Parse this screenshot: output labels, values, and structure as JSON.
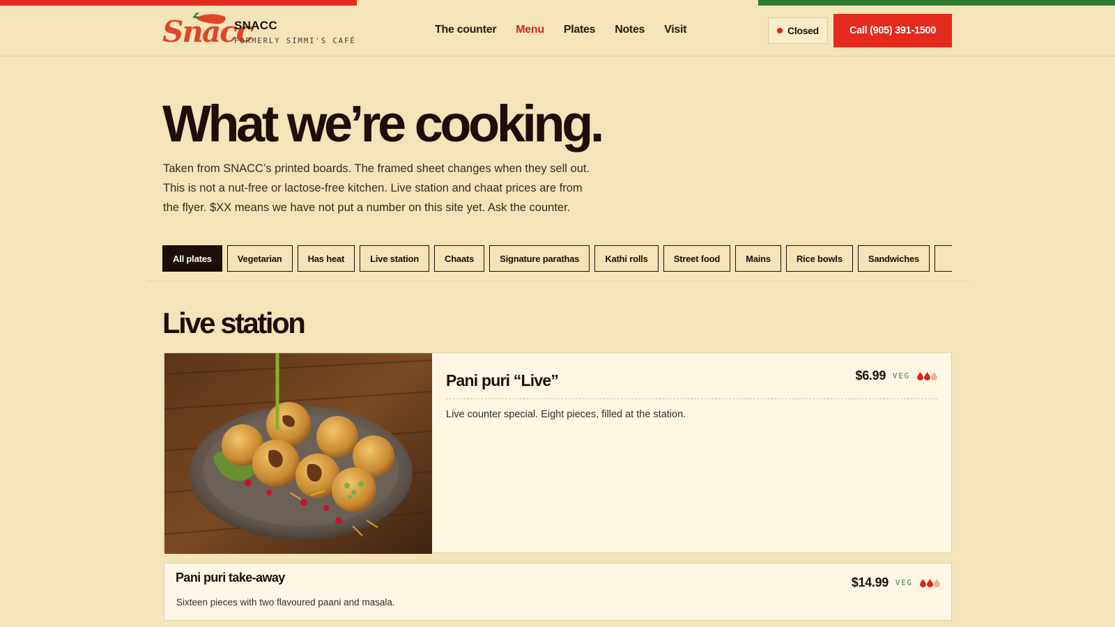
{
  "brand": {
    "logo_text": "Snacc",
    "name": "SNACC",
    "subtitle": "FORMERLY SIMMI'S CAFÉ"
  },
  "nav": {
    "items": [
      {
        "label": "The counter",
        "active": false
      },
      {
        "label": "Menu",
        "active": true
      },
      {
        "label": "Plates",
        "active": false
      },
      {
        "label": "Notes",
        "active": false
      },
      {
        "label": "Visit",
        "active": false
      }
    ]
  },
  "status": {
    "label": "Closed",
    "color": "#d72719"
  },
  "call_button": {
    "label": "Call (905) 391-1500"
  },
  "hero": {
    "title": "What we’re cooking.",
    "copy_lines": [
      "Taken from SNACC’s printed boards. The framed sheet changes when they sell out.",
      "This is not a nut-free or lactose-free kitchen. Live station and chaat prices are from",
      "the flyer. $XX means we have not put a number on this site yet. Ask the counter."
    ]
  },
  "filters": [
    {
      "label": "All plates",
      "active": true
    },
    {
      "label": "Vegetarian",
      "active": false
    },
    {
      "label": "Has heat",
      "active": false
    },
    {
      "label": "Live station",
      "active": false
    },
    {
      "label": "Chaats",
      "active": false
    },
    {
      "label": "Signature parathas",
      "active": false
    },
    {
      "label": "Kathi rolls",
      "active": false
    },
    {
      "label": "Street food",
      "active": false
    },
    {
      "label": "Mains",
      "active": false
    },
    {
      "label": "Rice bowls",
      "active": false
    },
    {
      "label": "Sandwiches",
      "active": false
    },
    {
      "label": "",
      "active": false
    }
  ],
  "section": {
    "title": "Live station",
    "featured": {
      "name": "Pani puri “Live”",
      "price": "$6.99",
      "tag": "VEG",
      "heat_level": 2,
      "heat_max": 3,
      "description": "Live counter special. Eight pieces, filled at the station."
    },
    "items": [
      {
        "name": "Pani puri take-away",
        "price": "$14.99",
        "tag": "VEG",
        "heat_level": 2,
        "heat_max": 3,
        "description": "Sixteen pieces with two flavoured paani and masala."
      }
    ]
  },
  "colors": {
    "accent_red": "#e42a1c",
    "accent_green": "#2e7d2e",
    "background": "#f3e4b9",
    "ink": "#1c0f0a"
  }
}
